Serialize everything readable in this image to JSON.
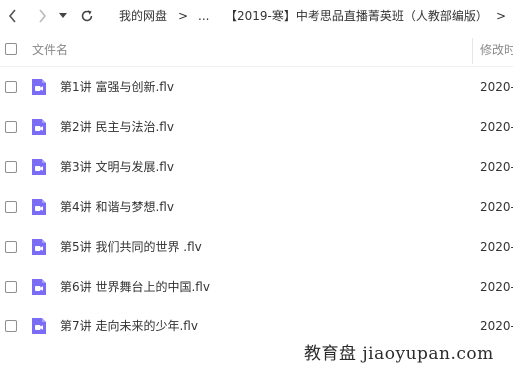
{
  "nav": {
    "back_icon": "chevron-left-icon",
    "forward_icon": "chevron-right-icon",
    "dropdown_icon": "caret-down-icon",
    "refresh_icon": "refresh-icon",
    "more_icon": "chevron-right-icon"
  },
  "breadcrumb": {
    "root": "我的网盘",
    "separator": ">",
    "ellipsis": "...",
    "current": "【2019-寒】中考思品直播菁英班（人教部编版）",
    "trailing": ">"
  },
  "header": {
    "name_label": "文件名",
    "modified_label": "修改时"
  },
  "files": [
    {
      "name": "第1讲 富强与创新.flv",
      "date": "2020-"
    },
    {
      "name": "第2讲 民主与法治.flv",
      "date": "2020-"
    },
    {
      "name": "第3讲 文明与发展.flv",
      "date": "2020-"
    },
    {
      "name": "第4讲 和谐与梦想.flv",
      "date": "2020-"
    },
    {
      "name": "第5讲 我们共同的世界 .flv",
      "date": "2020-"
    },
    {
      "name": "第6讲 世界舞台上的中国.flv",
      "date": "2020-"
    },
    {
      "name": "第7讲 走向未来的少年.flv",
      "date": "2020-"
    }
  ],
  "file_icon": "video-file-icon",
  "colors": {
    "icon_purple": "#7b6cf6",
    "text": "#333333",
    "muted": "#888888"
  },
  "watermark": "教育盘 jiaoyupan.com"
}
